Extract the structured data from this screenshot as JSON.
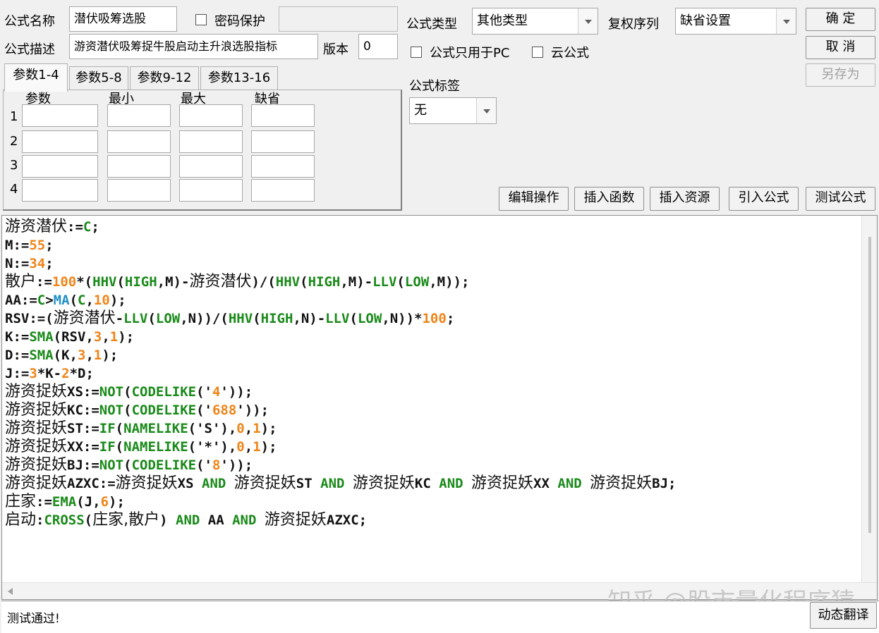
{
  "header": {
    "formula_name_label": "公式名称",
    "formula_name_value": "潜伏吸筹选股",
    "password_label": "密码保护",
    "formula_desc_label": "公式描述",
    "formula_desc_value": "游资潜伏吸筹捉牛股启动主升浪选股指标",
    "version_label": "版本",
    "version_value": "0",
    "formula_type_label": "公式类型",
    "formula_type_value": "其他类型",
    "restore_seq_label": "复权序列",
    "restore_seq_value": "缺省设置",
    "pc_only_label": "公式只用于PC",
    "cloud_label": "云公式",
    "tag_label": "公式标签",
    "tag_value": "无"
  },
  "buttons": {
    "confirm": "确 定",
    "cancel": "取 消",
    "save_as": "另存为",
    "edit_ops": "编辑操作",
    "insert_func": "插入函数",
    "insert_res": "插入资源",
    "import_formula": "引入公式",
    "test_formula": "测试公式",
    "dyn_translate": "动态翻译"
  },
  "tabs": [
    "参数1-4",
    "参数5-8",
    "参数9-12",
    "参数13-16"
  ],
  "params": {
    "columns": [
      "参数",
      "最小",
      "最大",
      "缺省"
    ],
    "rows": [
      "1",
      "2",
      "3",
      "4"
    ]
  },
  "code_lines": [
    [
      [
        "cn",
        "游资潜伏"
      ],
      [
        "t",
        ":="
      ],
      [
        "fn",
        "C"
      ],
      [
        "t",
        ";"
      ]
    ],
    [
      [
        "t",
        "M:="
      ],
      [
        "num",
        "55"
      ],
      [
        "t",
        ";"
      ]
    ],
    [
      [
        "t",
        "N:="
      ],
      [
        "num",
        "34"
      ],
      [
        "t",
        ";"
      ]
    ],
    [
      [
        "cn",
        "散户"
      ],
      [
        "t",
        ":="
      ],
      [
        "num",
        "100"
      ],
      [
        "t",
        "*("
      ],
      [
        "fn",
        "HHV"
      ],
      [
        "t",
        "("
      ],
      [
        "fn",
        "HIGH"
      ],
      [
        "t",
        ",M)-"
      ],
      [
        "cn",
        "游资潜伏"
      ],
      [
        "t",
        ")/("
      ],
      [
        "fn",
        "HHV"
      ],
      [
        "t",
        "("
      ],
      [
        "fn",
        "HIGH"
      ],
      [
        "t",
        ",M)-"
      ],
      [
        "fn",
        "LLV"
      ],
      [
        "t",
        "("
      ],
      [
        "fn",
        "LOW"
      ],
      [
        "t",
        ",M));"
      ]
    ],
    [
      [
        "t",
        "AA:="
      ],
      [
        "fn",
        "C"
      ],
      [
        "t",
        ">"
      ],
      [
        "blue",
        "MA"
      ],
      [
        "t",
        "("
      ],
      [
        "fn",
        "C"
      ],
      [
        "t",
        ","
      ],
      [
        "num",
        "10"
      ],
      [
        "t",
        ");"
      ]
    ],
    [
      [
        "t",
        "RSV:=("
      ],
      [
        "cn",
        "游资潜伏"
      ],
      [
        "t",
        "-"
      ],
      [
        "fn",
        "LLV"
      ],
      [
        "t",
        "("
      ],
      [
        "fn",
        "LOW"
      ],
      [
        "t",
        ",N))/("
      ],
      [
        "fn",
        "HHV"
      ],
      [
        "t",
        "("
      ],
      [
        "fn",
        "HIGH"
      ],
      [
        "t",
        ",N)-"
      ],
      [
        "fn",
        "LLV"
      ],
      [
        "t",
        "("
      ],
      [
        "fn",
        "LOW"
      ],
      [
        "t",
        ",N))*"
      ],
      [
        "num",
        "100"
      ],
      [
        "t",
        ";"
      ]
    ],
    [
      [
        "t",
        "K:="
      ],
      [
        "fn",
        "SMA"
      ],
      [
        "t",
        "(RSV,"
      ],
      [
        "num",
        "3"
      ],
      [
        "t",
        ","
      ],
      [
        "num",
        "1"
      ],
      [
        "t",
        ");"
      ]
    ],
    [
      [
        "t",
        "D:="
      ],
      [
        "fn",
        "SMA"
      ],
      [
        "t",
        "(K,"
      ],
      [
        "num",
        "3"
      ],
      [
        "t",
        ","
      ],
      [
        "num",
        "1"
      ],
      [
        "t",
        ");"
      ]
    ],
    [
      [
        "t",
        "J:="
      ],
      [
        "num",
        "3"
      ],
      [
        "t",
        "*K-"
      ],
      [
        "num",
        "2"
      ],
      [
        "t",
        "*D;"
      ]
    ],
    [
      [
        "cn",
        "游资捉妖"
      ],
      [
        "t",
        "XS:="
      ],
      [
        "fn",
        "NOT"
      ],
      [
        "t",
        "("
      ],
      [
        "fn",
        "CODELIKE"
      ],
      [
        "t",
        "('"
      ],
      [
        "num",
        "4"
      ],
      [
        "t",
        "'));"
      ]
    ],
    [
      [
        "cn",
        "游资捉妖"
      ],
      [
        "t",
        "KC:="
      ],
      [
        "fn",
        "NOT"
      ],
      [
        "t",
        "("
      ],
      [
        "fn",
        "CODELIKE"
      ],
      [
        "t",
        "('"
      ],
      [
        "num",
        "688"
      ],
      [
        "t",
        "'));"
      ]
    ],
    [
      [
        "cn",
        "游资捉妖"
      ],
      [
        "t",
        "ST:="
      ],
      [
        "fn",
        "IF"
      ],
      [
        "t",
        "("
      ],
      [
        "fn",
        "NAMELIKE"
      ],
      [
        "t",
        "('S'),"
      ],
      [
        "num",
        "0"
      ],
      [
        "t",
        ","
      ],
      [
        "num",
        "1"
      ],
      [
        "t",
        ");"
      ]
    ],
    [
      [
        "cn",
        "游资捉妖"
      ],
      [
        "t",
        "XX:="
      ],
      [
        "fn",
        "IF"
      ],
      [
        "t",
        "("
      ],
      [
        "fn",
        "NAMELIKE"
      ],
      [
        "t",
        "('*'),"
      ],
      [
        "num",
        "0"
      ],
      [
        "t",
        ","
      ],
      [
        "num",
        "1"
      ],
      [
        "t",
        ");"
      ]
    ],
    [
      [
        "cn",
        "游资捉妖"
      ],
      [
        "t",
        "BJ:="
      ],
      [
        "fn",
        "NOT"
      ],
      [
        "t",
        "("
      ],
      [
        "fn",
        "CODELIKE"
      ],
      [
        "t",
        "('"
      ],
      [
        "num",
        "8"
      ],
      [
        "t",
        "'));"
      ]
    ],
    [
      [
        "cn",
        "游资捉妖"
      ],
      [
        "t",
        "AZXC:="
      ],
      [
        "cn",
        "游资捉妖"
      ],
      [
        "t",
        "XS "
      ],
      [
        "kw",
        "AND"
      ],
      [
        "t",
        " "
      ],
      [
        "cn",
        "游资捉妖"
      ],
      [
        "t",
        "ST "
      ],
      [
        "kw",
        "AND"
      ],
      [
        "t",
        " "
      ],
      [
        "cn",
        "游资捉妖"
      ],
      [
        "t",
        "KC "
      ],
      [
        "kw",
        "AND"
      ],
      [
        "t",
        " "
      ],
      [
        "cn",
        "游资捉妖"
      ],
      [
        "t",
        "XX "
      ],
      [
        "kw",
        "AND"
      ],
      [
        "t",
        " "
      ],
      [
        "cn",
        "游资捉妖"
      ],
      [
        "t",
        "BJ;"
      ]
    ],
    [
      [
        "cn",
        "庄家"
      ],
      [
        "t",
        ":="
      ],
      [
        "fn",
        "EMA"
      ],
      [
        "t",
        "(J,"
      ],
      [
        "num",
        "6"
      ],
      [
        "t",
        ");"
      ]
    ],
    [
      [
        "cn",
        "启动"
      ],
      [
        "t",
        ":"
      ],
      [
        "fn",
        "CROSS"
      ],
      [
        "t",
        "("
      ],
      [
        "cn",
        "庄家,散户"
      ],
      [
        "t",
        ") "
      ],
      [
        "kw",
        "AND"
      ],
      [
        "t",
        " AA "
      ],
      [
        "kw",
        "AND"
      ],
      [
        "t",
        " "
      ],
      [
        "cn",
        "游资捉妖"
      ],
      [
        "t",
        "AZXC;"
      ]
    ]
  ],
  "status_text": "测试通过!",
  "watermark": "知乎 @股市量化程序猿"
}
